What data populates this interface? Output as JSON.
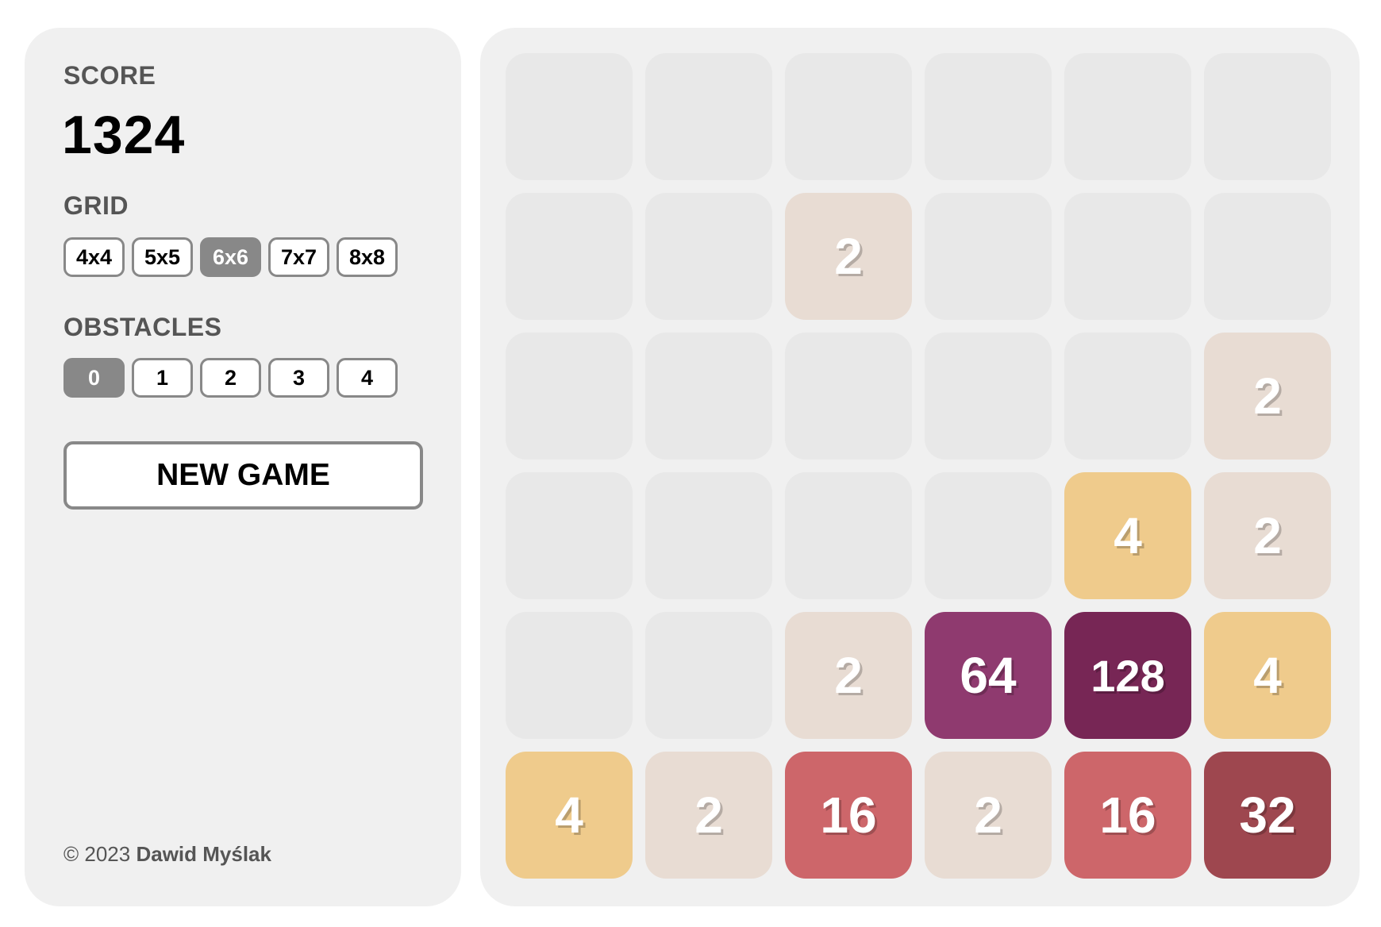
{
  "score": {
    "label": "SCORE",
    "value": "1324"
  },
  "grid_select": {
    "label": "GRID",
    "options": [
      "4x4",
      "5x5",
      "6x6",
      "7x7",
      "8x8"
    ],
    "selected": "6x6"
  },
  "obstacles_select": {
    "label": "OBSTACLES",
    "options": [
      "0",
      "1",
      "2",
      "3",
      "4"
    ],
    "selected": "0"
  },
  "new_game_label": "NEW GAME",
  "footer": {
    "copyright": "© 2023 ",
    "author": "Dawid Myślak"
  },
  "board": {
    "size": 6,
    "cells": [
      [
        null,
        null,
        null,
        null,
        null,
        null
      ],
      [
        null,
        null,
        2,
        null,
        null,
        null
      ],
      [
        null,
        null,
        null,
        null,
        null,
        2
      ],
      [
        null,
        null,
        null,
        null,
        4,
        2
      ],
      [
        null,
        null,
        2,
        64,
        128,
        4
      ],
      [
        4,
        2,
        16,
        2,
        16,
        32
      ]
    ]
  },
  "colors": {
    "empty": "#e8e8e8",
    "tile_2": "#e8dcd3",
    "tile_4": "#efcb8c",
    "tile_16": "#cd666a",
    "tile_32": "#9e474f",
    "tile_64": "#8f3a6f",
    "tile_128": "#772655",
    "panel_bg": "#f0f0f0",
    "accent_gray": "#888888"
  }
}
